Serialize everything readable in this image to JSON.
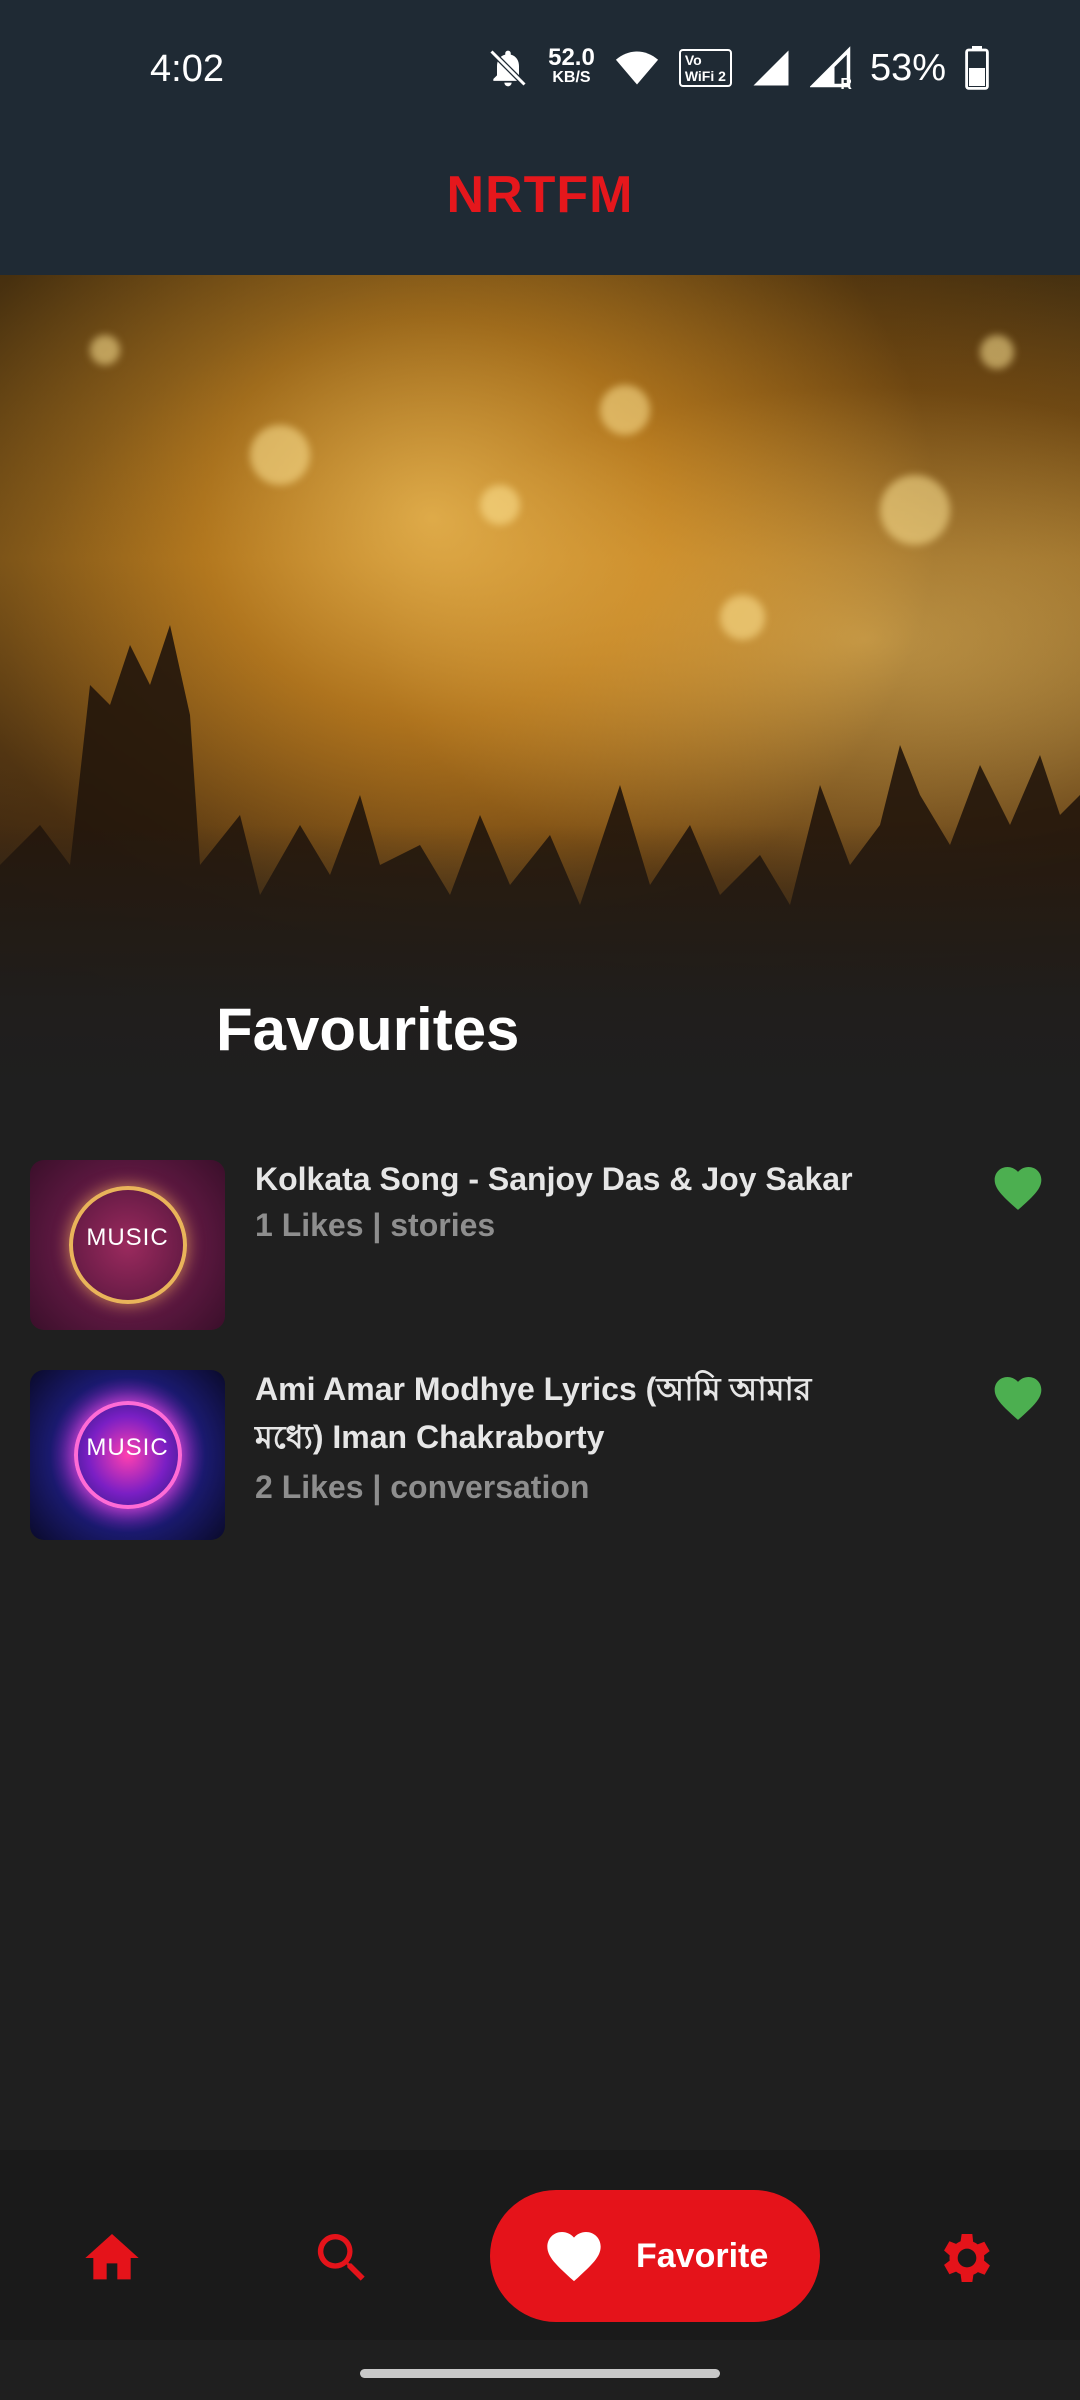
{
  "status_bar": {
    "time": "4:02",
    "net_speed_value": "52.0",
    "net_speed_unit": "KB/S",
    "wifi_badge_top": "Vo",
    "wifi_badge_bottom": "WiFi 2",
    "roaming_badge": "R",
    "battery_percent": "53%",
    "icons": [
      "bell-off-icon",
      "wifi-icon",
      "vowifi-icon",
      "signal-icon",
      "signal-roaming-icon",
      "battery-icon"
    ]
  },
  "app_bar": {
    "title": "NRTFM",
    "title_color": "#e5171c"
  },
  "hero": {
    "title": "Favourites"
  },
  "favourites": [
    {
      "title": "Kolkata Song - Sanjoy Das & Joy Sakar",
      "meta": "1 Likes | stories",
      "thumbnail_text": "MUSIC",
      "liked": true
    },
    {
      "title": "Ami Amar Modhye Lyrics (আমি আমার মধ্যে) Iman Chakraborty",
      "meta": "2 Likes | conversation",
      "thumbnail_text": "MUSIC",
      "liked": true
    }
  ],
  "bottom_nav": {
    "items": [
      {
        "icon": "home-icon"
      },
      {
        "icon": "search-icon"
      },
      {
        "icon": "heart-icon",
        "label": "Favorite",
        "active": true
      },
      {
        "icon": "gear-icon"
      }
    ]
  },
  "colors": {
    "accent": "#e5131a",
    "like_green": "#4caf50",
    "background": "#1f1f1f",
    "header": "#1f2a34"
  }
}
